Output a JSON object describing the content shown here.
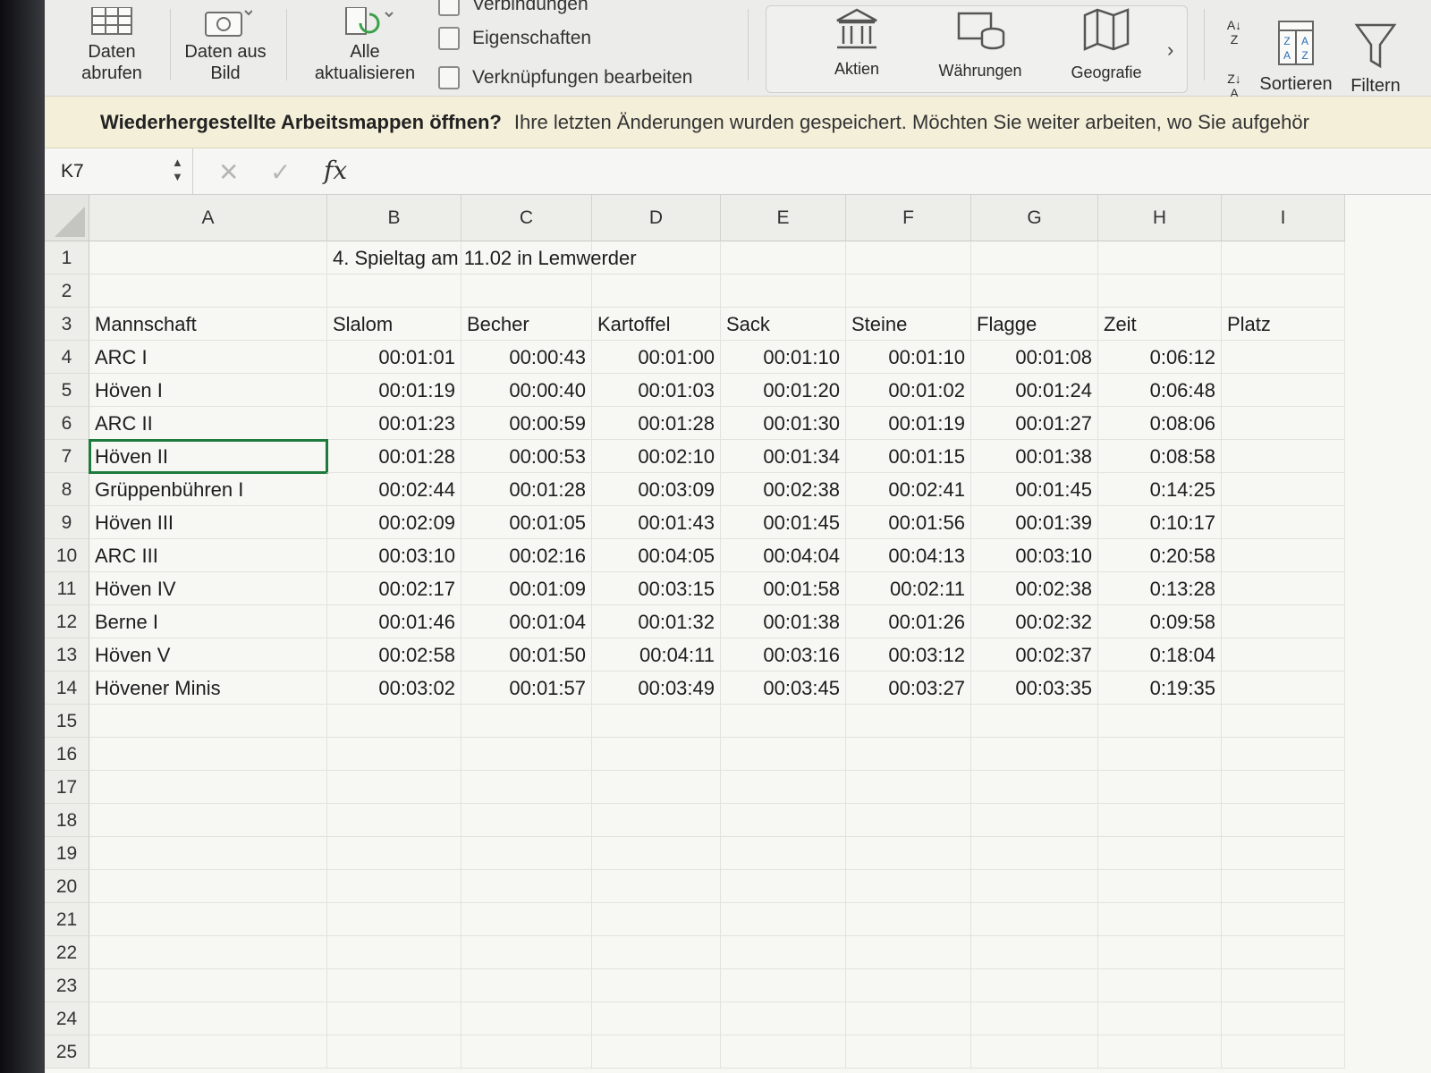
{
  "ribbon": {
    "get_data": "Daten abrufen",
    "data_from_picture": "Daten aus Bild",
    "refresh_all": "Alle aktualisieren",
    "connections": "Verbindungen",
    "properties": "Eigenschaften",
    "edit_links": "Verknüpfungen bearbeiten",
    "stocks": "Aktien",
    "currencies": "Währungen",
    "geography": "Geografie",
    "sort": "Sortieren",
    "filter": "Filtern"
  },
  "banner": {
    "question": "Wiederhergestellte Arbeitsmappen öffnen?",
    "message": "Ihre letzten Änderungen wurden gespeichert. Möchten Sie weiter arbeiten, wo Sie aufgehör"
  },
  "formula_bar": {
    "name_box": "K7",
    "fx": "fx",
    "formula": ""
  },
  "columns": [
    "A",
    "B",
    "C",
    "D",
    "E",
    "F",
    "G",
    "H",
    "I"
  ],
  "row_numbers": [
    "1",
    "2",
    "3",
    "4",
    "5",
    "6",
    "7",
    "8",
    "9",
    "10",
    "11",
    "12",
    "13",
    "14",
    "15",
    "16",
    "17",
    "18",
    "19",
    "20",
    "21",
    "22",
    "23",
    "24",
    "25"
  ],
  "sheet": {
    "title": "4. Spieltag am 11.02 in Lemwerder",
    "headers": [
      "Mannschaft",
      "Slalom",
      "Becher",
      "Kartoffel",
      "Sack",
      "Steine",
      "Flagge",
      "Zeit",
      "Platz"
    ],
    "rows": [
      [
        "ARC I",
        "00:01:01",
        "00:00:43",
        "00:01:00",
        "00:01:10",
        "00:01:10",
        "00:01:08",
        "0:06:12",
        ""
      ],
      [
        "Höven I",
        "00:01:19",
        "00:00:40",
        "00:01:03",
        "00:01:20",
        "00:01:02",
        "00:01:24",
        "0:06:48",
        ""
      ],
      [
        "ARC II",
        "00:01:23",
        "00:00:59",
        "00:01:28",
        "00:01:30",
        "00:01:19",
        "00:01:27",
        "0:08:06",
        ""
      ],
      [
        "Höven II",
        "00:01:28",
        "00:00:53",
        "00:02:10",
        "00:01:34",
        "00:01:15",
        "00:01:38",
        "0:08:58",
        ""
      ],
      [
        "Grüppenbühren I",
        "00:02:44",
        "00:01:28",
        "00:03:09",
        "00:02:38",
        "00:02:41",
        "00:01:45",
        "0:14:25",
        ""
      ],
      [
        "Höven III",
        "00:02:09",
        "00:01:05",
        "00:01:43",
        "00:01:45",
        "00:01:56",
        "00:01:39",
        "0:10:17",
        ""
      ],
      [
        "ARC III",
        "00:03:10",
        "00:02:16",
        "00:04:05",
        "00:04:04",
        "00:04:13",
        "00:03:10",
        "0:20:58",
        ""
      ],
      [
        "Höven IV",
        "00:02:17",
        "00:01:09",
        "00:03:15",
        "00:01:58",
        "00:02:11",
        "00:02:38",
        "0:13:28",
        ""
      ],
      [
        "Berne I",
        "00:01:46",
        "00:01:04",
        "00:01:32",
        "00:01:38",
        "00:01:26",
        "00:02:32",
        "0:09:58",
        ""
      ],
      [
        "Höven V",
        "00:02:58",
        "00:01:50",
        "00:04:11",
        "00:03:16",
        "00:03:12",
        "00:02:37",
        "0:18:04",
        ""
      ],
      [
        "Hövener Minis",
        "00:03:02",
        "00:01:57",
        "00:03:49",
        "00:03:45",
        "00:03:27",
        "00:03:35",
        "0:19:35",
        ""
      ]
    ]
  },
  "colors": {
    "selection": "#1f7a3e",
    "banner": "#f4efd9"
  }
}
